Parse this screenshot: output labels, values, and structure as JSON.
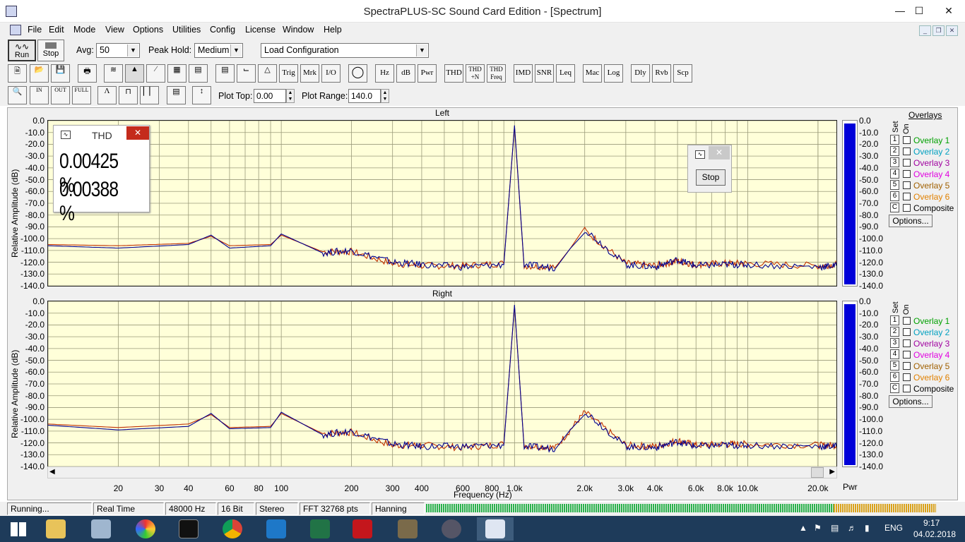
{
  "window": {
    "title": "SpectraPLUS-SC Sound Card Edition - [Spectrum]"
  },
  "menu": [
    "File",
    "Edit",
    "Mode",
    "View",
    "Options",
    "Utilities",
    "Config",
    "License",
    "Window",
    "Help"
  ],
  "toolbar1": {
    "run": "Run",
    "stop": "Stop",
    "avg_label": "Avg:",
    "avg_value": "50",
    "peak_label": "Peak Hold:",
    "peak_value": "Medium",
    "config_value": "Load Configuration"
  },
  "toolbar2": [
    "Trig",
    "Mrk",
    "I/O",
    "Hz",
    "dB",
    "Pwr",
    "THD",
    "THD +N",
    "THD Freq",
    "IMD",
    "SNR",
    "Leq",
    "Mac",
    "Log",
    "Dly",
    "Rvb",
    "Scp"
  ],
  "toolbar3": {
    "plot_top_label": "Plot Top:",
    "plot_top_value": "0.00",
    "plot_range_label": "Plot Range:",
    "plot_range_value": "140.0"
  },
  "panels": {
    "left_title": "Left",
    "right_title": "Right",
    "ylabel": "Relative Amplitude (dB)",
    "xlabel": "Frequency (Hz)",
    "pwr_label": "Pwr"
  },
  "overlays": {
    "title": "Overlays",
    "set": "Set",
    "on": "On",
    "items": [
      {
        "n": "1",
        "name": "Overlay 1",
        "color": "#00a000"
      },
      {
        "n": "2",
        "name": "Overlay 2",
        "color": "#00a0c0"
      },
      {
        "n": "3",
        "name": "Overlay 3",
        "color": "#a000a0"
      },
      {
        "n": "4",
        "name": "Overlay 4",
        "color": "#e000e0"
      },
      {
        "n": "5",
        "name": "Overlay 5",
        "color": "#a06000"
      },
      {
        "n": "6",
        "name": "Overlay 6",
        "color": "#e08000"
      },
      {
        "n": "C",
        "name": "Composite",
        "color": "#000000"
      }
    ],
    "options": "Options..."
  },
  "yticks": [
    "0.0",
    "-10.0",
    "-20.0",
    "-30.0",
    "-40.0",
    "-50.0",
    "-60.0",
    "-70.0",
    "-80.0",
    "-90.0",
    "-100.0",
    "-110.0",
    "-120.0",
    "-130.0",
    "-140.0"
  ],
  "xticks": [
    "20",
    "30",
    "40",
    "60",
    "80",
    "100",
    "200",
    "300",
    "400",
    "600",
    "800",
    "1.0k",
    "2.0k",
    "3.0k",
    "4.0k",
    "6.0k",
    "8.0k",
    "10.0k",
    "20.0k"
  ],
  "thd": {
    "title": "THD",
    "value1": "0.00425 %",
    "value2": "0.00388 %"
  },
  "stopwin": {
    "button": "Stop"
  },
  "status": [
    "Running...",
    "Real Time",
    "48000 Hz",
    "16 Bit",
    "Stereo",
    "FFT 32768 pts",
    "Hanning"
  ],
  "tray": {
    "lang": "ENG",
    "time": "9:17",
    "date": "04.02.2018"
  },
  "chart_data": [
    {
      "type": "line",
      "title": "Left",
      "xlabel": "Frequency (Hz)",
      "ylabel": "Relative Amplitude (dB)",
      "x_scale": "log",
      "xlim": [
        10,
        24000
      ],
      "ylim": [
        -140,
        0
      ],
      "grid": true,
      "series": [
        {
          "color": "#000090",
          "x": [
            10,
            20,
            40,
            50,
            60,
            90,
            100,
            150,
            200,
            300,
            400,
            600,
            900,
            1000,
            1100,
            1500,
            2000,
            3000,
            4000,
            5000,
            6000,
            8000,
            10000,
            20000,
            24000
          ],
          "values": [
            -106,
            -108,
            -105,
            -97,
            -108,
            -106,
            -96,
            -112,
            -110,
            -120,
            -122,
            -124,
            -122,
            -4,
            -122,
            -125,
            -92,
            -122,
            -124,
            -118,
            -123,
            -122,
            -122,
            -124,
            -123
          ]
        },
        {
          "color": "#c03000",
          "x": [
            10,
            20,
            40,
            50,
            60,
            90,
            100,
            150,
            200,
            300,
            400,
            600,
            900,
            1000,
            1100,
            1500,
            2000,
            3000,
            4000,
            5000,
            6000,
            8000,
            10000,
            20000,
            24000
          ],
          "values": [
            -105,
            -106,
            -104,
            -98,
            -106,
            -105,
            -97,
            -111,
            -111,
            -121,
            -123,
            -123,
            -121,
            -5,
            -123,
            -124,
            -93,
            -121,
            -123,
            -119,
            -122,
            -121,
            -121,
            -123,
            -122
          ]
        }
      ]
    },
    {
      "type": "line",
      "title": "Right",
      "xlabel": "Frequency (Hz)",
      "ylabel": "Relative Amplitude (dB)",
      "x_scale": "log",
      "xlim": [
        10,
        24000
      ],
      "ylim": [
        -140,
        0
      ],
      "grid": true,
      "series": [
        {
          "color": "#000090",
          "x": [
            10,
            20,
            40,
            50,
            60,
            90,
            100,
            150,
            200,
            300,
            400,
            600,
            900,
            1000,
            1100,
            1500,
            2000,
            3000,
            4000,
            5000,
            6000,
            8000,
            10000,
            20000,
            24000
          ],
          "values": [
            -105,
            -109,
            -106,
            -95,
            -108,
            -107,
            -94,
            -113,
            -110,
            -121,
            -123,
            -123,
            -122,
            -3,
            -123,
            -125,
            -93,
            -123,
            -124,
            -119,
            -123,
            -122,
            -122,
            -123,
            -123
          ]
        },
        {
          "color": "#c03000",
          "x": [
            10,
            20,
            40,
            50,
            60,
            90,
            100,
            150,
            200,
            300,
            400,
            600,
            900,
            1000,
            1100,
            1500,
            2000,
            3000,
            4000,
            5000,
            6000,
            8000,
            10000,
            20000,
            24000
          ],
          "values": [
            -104,
            -107,
            -104,
            -96,
            -107,
            -106,
            -95,
            -112,
            -111,
            -122,
            -122,
            -124,
            -121,
            -4,
            -122,
            -124,
            -94,
            -122,
            -123,
            -118,
            -122,
            -121,
            -121,
            -122,
            -122
          ]
        }
      ]
    }
  ]
}
